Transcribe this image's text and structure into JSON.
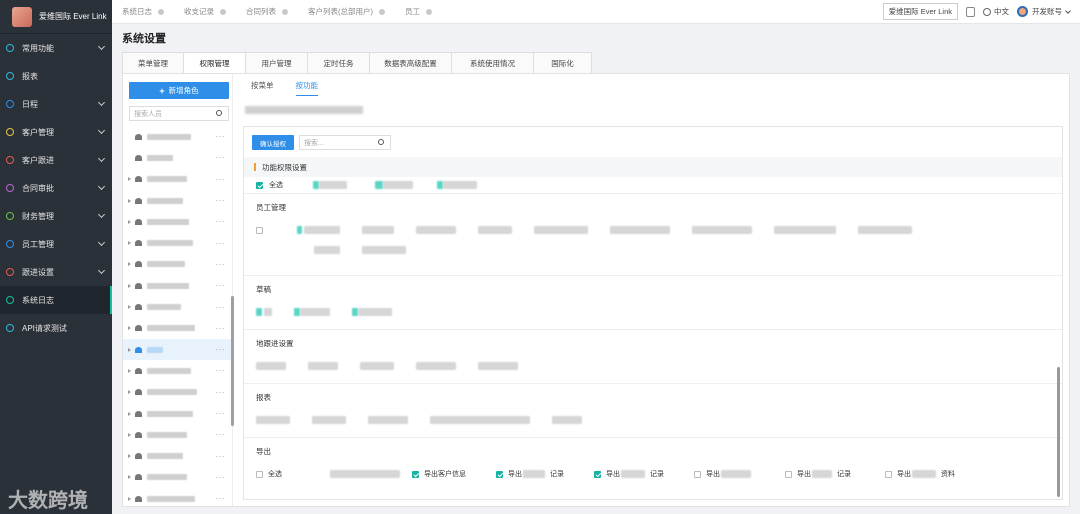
{
  "app": {
    "logo_text": "爱维国际 Ever Link"
  },
  "sidebar": {
    "items": [
      {
        "label": "常用功能",
        "color": "#2fb8d9",
        "chevron": true
      },
      {
        "label": "报表",
        "color": "#2fb8d9",
        "chevron": false
      },
      {
        "label": "日程",
        "color": "#2f8fe8",
        "chevron": true
      },
      {
        "label": "客户管理",
        "color": "#e6c84a",
        "chevron": true
      },
      {
        "label": "客户跟进",
        "color": "#e65a4f",
        "chevron": true
      },
      {
        "label": "合同审批",
        "color": "#b866d6",
        "chevron": true
      },
      {
        "label": "财务管理",
        "color": "#6cc24a",
        "chevron": true
      },
      {
        "label": "员工管理",
        "color": "#2f8fe8",
        "chevron": true
      },
      {
        "label": "跟进设置",
        "color": "#e65a4f",
        "chevron": true
      },
      {
        "label": "系统日志",
        "color": "#14c0a0",
        "chevron": false,
        "active": true
      },
      {
        "label": "API请求测试",
        "color": "#2fb8d9",
        "chevron": false
      }
    ],
    "watermark": "大数跨境"
  },
  "topbar": {
    "tabs": [
      "系统日志",
      "收支记录",
      "合同列表",
      "客户列表(总部用户)",
      "员工"
    ],
    "org_button": "爱维国际 Ever Link",
    "language": "中文",
    "account": "开发账号"
  },
  "page": {
    "title": "系统设置",
    "tabs": [
      {
        "label": "菜单管理"
      },
      {
        "label": "权限管理",
        "active": true
      },
      {
        "label": "用户管理"
      },
      {
        "label": "定时任务"
      },
      {
        "label": "数据表高级配置"
      },
      {
        "label": "系统使用情况"
      },
      {
        "label": "国际化"
      }
    ]
  },
  "roles": {
    "add_button": "新增角色",
    "search_placeholder": "搜索人员"
  },
  "permissions": {
    "subtabs": [
      {
        "label": "按菜单"
      },
      {
        "label": "按功能",
        "active": true
      }
    ],
    "confirm_button": "确认授权",
    "search_placeholder": "搜索...",
    "header": "功能权限设置",
    "select_all": "全选",
    "sections": [
      "员工管理",
      "草稿",
      "地跟进设置",
      "报表",
      "导出"
    ],
    "export_items": [
      {
        "label": "全选",
        "checked": false
      },
      {
        "label": "导出客户信息",
        "checked": true
      },
      {
        "label": "导出",
        "suffix": "记录",
        "checked": true
      },
      {
        "label": "导出",
        "suffix": "记录",
        "checked": true
      },
      {
        "label": "导出",
        "suffix": "",
        "checked": false
      },
      {
        "label": "导出",
        "suffix": "记录",
        "checked": false
      },
      {
        "label": "导出",
        "suffix": "资料",
        "checked": false
      }
    ]
  }
}
